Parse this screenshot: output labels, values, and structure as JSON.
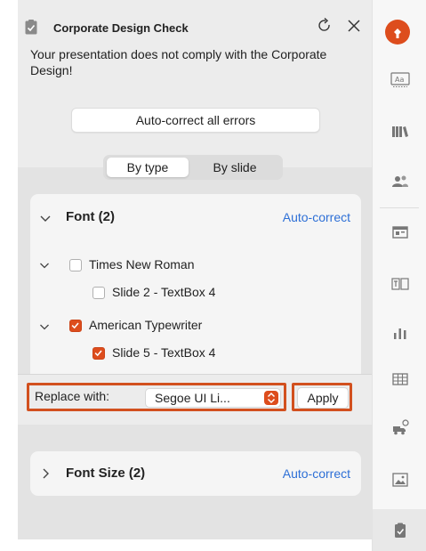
{
  "header": {
    "title": "Corporate Design Check",
    "icon": "clipboard-check-icon",
    "refresh_icon": "refresh-icon",
    "close_icon": "close-icon"
  },
  "warning_text": "Your presentation does not comply with the Corporate Design!",
  "auto_correct_all_label": "Auto-correct all errors",
  "view_toggle": {
    "options": [
      "By type",
      "By slide"
    ],
    "selected": "By type"
  },
  "font_section": {
    "title": "Font (2)",
    "expanded": true,
    "auto_correct_label": "Auto-correct",
    "fonts": [
      {
        "name": "Times New Roman",
        "checked": false,
        "expanded": true,
        "occurrences": [
          {
            "label": "Slide 2 - TextBox 4",
            "checked": false
          }
        ]
      },
      {
        "name": "American Typewriter",
        "checked": true,
        "expanded": true,
        "occurrences": [
          {
            "label": "Slide 5 - TextBox 4",
            "checked": true
          }
        ]
      }
    ],
    "replace": {
      "label": "Replace with:",
      "selected_font": "Segoe UI Li...",
      "apply_label": "Apply"
    }
  },
  "font_size_section": {
    "title": "Font Size (2)",
    "expanded": false,
    "auto_correct_label": "Auto-correct"
  },
  "toolbar": {
    "items": [
      "brand-logo-icon",
      "text-style-icon",
      "library-icon",
      "team-icon",
      "layout-icon",
      "text-box-icon",
      "bar-chart-icon",
      "table-icon",
      "truck-icon",
      "image-icon",
      "clipboard-check-icon"
    ],
    "active": "clipboard-check-icon"
  },
  "colors": {
    "accent": "#dd4d1d",
    "link": "#2d6fd6",
    "highlight_frame": "#d2501e"
  }
}
